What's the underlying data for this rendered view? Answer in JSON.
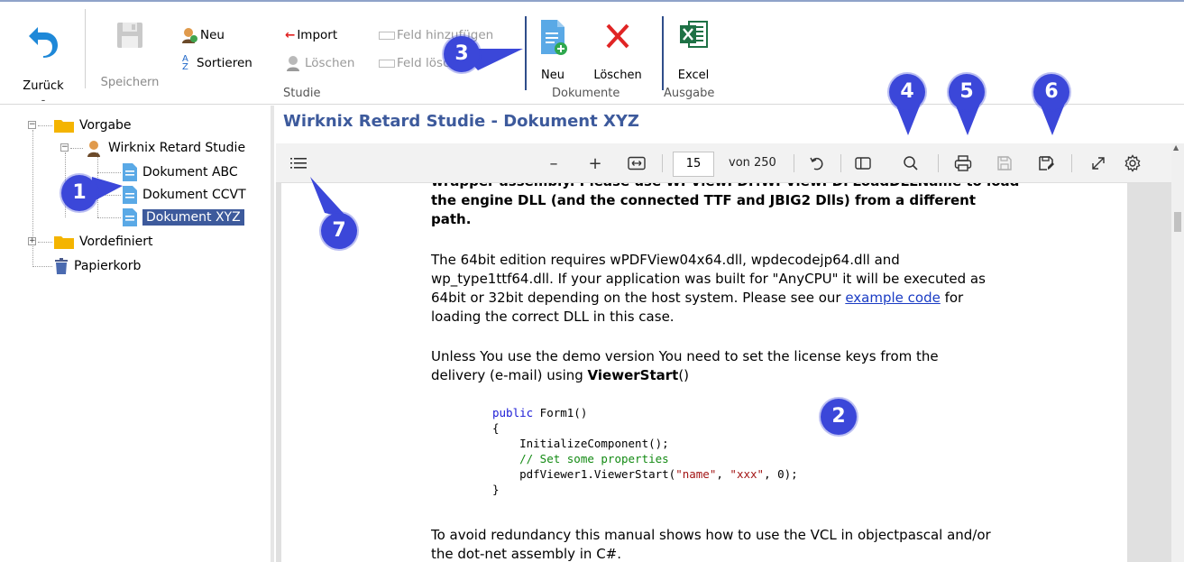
{
  "ribbon": {
    "back_label": "Zurück",
    "back_sub": "-",
    "save_label": "Speichern",
    "new_label": "Neu",
    "sort_label": "Sortieren",
    "import_label": "Import",
    "delete_label": "Löschen",
    "add_field_label": "Feld hinzufügen",
    "delete_field_label": "Feld löschen",
    "group_study": "Studie",
    "doc_new_label": "Neu",
    "doc_delete_label": "Löschen",
    "group_documents": "Dokumente",
    "excel_label": "Excel",
    "group_output": "Ausgabe"
  },
  "tree": {
    "root": "Vorgabe",
    "study": "Wirknix Retard Studie",
    "docs": [
      "Dokument ABC",
      "Dokument CCVT",
      "Dokument XYZ"
    ],
    "predefined": "Vordefiniert",
    "trash": "Papierkorb"
  },
  "document": {
    "title": "Wirknix Retard Studie - Dokument XYZ"
  },
  "pdf_toolbar": {
    "page_value": "15",
    "page_of": "von 250"
  },
  "page": {
    "line_top": "wrapper assembly. Please use WPViewPDF.WPViewPDFLoadDLLName to load",
    "bold_lines": [
      "the engine DLL (and the connected TTF and JBIG2 Dlls) from a different",
      "path."
    ],
    "p2_lines": [
      "The 64bit edition requires wPDFView04x64.dll, wpdecodejp64.dll and",
      "wp_type1ttf64.dll. If your application was built for \"AnyCPU\" it will be executed as",
      "64bit or 32bit depending on the host system. Please see our "
    ],
    "p2_link": "example code",
    "p2_after_link": " for",
    "p2_last": "loading the correct DLL in this case.",
    "p3_line1": "Unless You use the demo version You need to set the license keys from the",
    "p3_line2_pre": "delivery (e-mail) using ",
    "p3_line2_bold": "ViewerStart",
    "p3_line2_post": "()",
    "code": {
      "l1_kw": "public",
      "l1_rest": " Form1()",
      "l2": "{",
      "l3": "    InitializeComponent();",
      "l4": "    // Set some properties",
      "l5_pre": "    pdfViewer1.ViewerStart(",
      "l5_s1": "\"name\"",
      "l5_mid": ", ",
      "l5_s2": "\"xxx\"",
      "l5_post": ", 0);",
      "l6": "}"
    },
    "p4_line1": "To avoid redundancy this manual shows how to use the VCL in objectpascal and/or",
    "p4_line2": "the dot-net assembly in C#."
  },
  "callouts": [
    "1",
    "2",
    "3",
    "4",
    "5",
    "6",
    "7"
  ],
  "colors": {
    "accent": "#3d5a9c",
    "callout": "#3b47d9",
    "link": "#1a3cc4",
    "code_keyword": "#1a1ad6",
    "code_comment": "#138a13",
    "code_string": "#a31515"
  }
}
